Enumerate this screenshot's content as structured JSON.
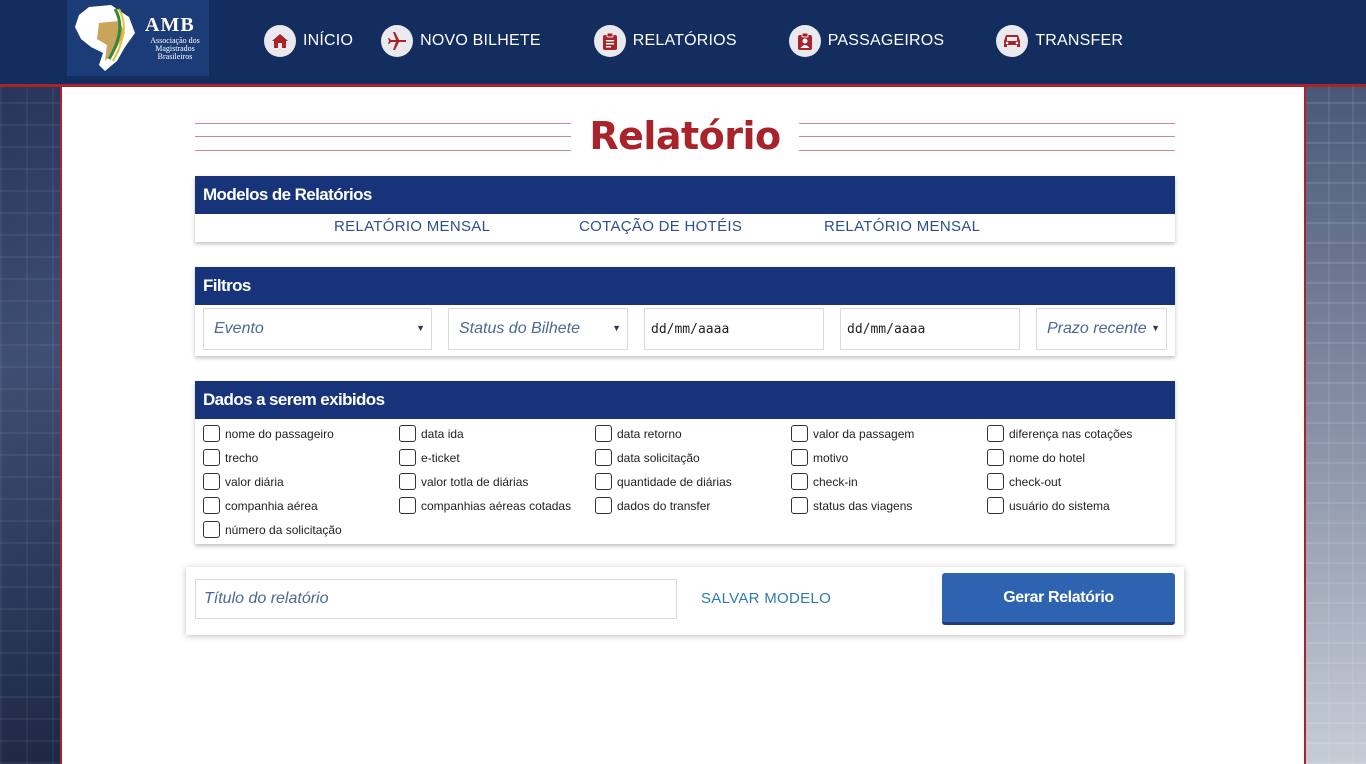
{
  "brand": {
    "logo_name": "AMB",
    "logo_subtitle": "Associação dos Magistrados Brasileiros"
  },
  "nav": {
    "items": [
      {
        "label": "INÍCIO",
        "icon": "home-icon"
      },
      {
        "label": "NOVO BILHETE",
        "icon": "airplane-icon"
      },
      {
        "label": "RELATÓRIOS",
        "icon": "clipboard-icon"
      },
      {
        "label": "PASSAGEIROS",
        "icon": "id-badge-icon"
      },
      {
        "label": "TRANSFER",
        "icon": "car-icon"
      }
    ]
  },
  "page": {
    "title": "Relatório"
  },
  "models": {
    "heading": "Modelos de Relatórios",
    "links": [
      "RELATÓRIO MENSAL",
      "COTAÇÃO DE HOTÉIS",
      "RELATÓRIO MENSAL"
    ]
  },
  "filters": {
    "heading": "Filtros",
    "evento": "Evento",
    "status": "Status do Bilhete",
    "date_from": "dd/mm/aaaa",
    "date_to": "dd/mm/aaaa",
    "prazo": "Prazo recente"
  },
  "data_fields": {
    "heading": "Dados a serem exibidos",
    "columns": [
      [
        "nome do passageiro",
        "trecho",
        "valor diária",
        "companhia aérea",
        "número da solicitação"
      ],
      [
        "data ida",
        "e-ticket",
        "valor totla de diárias",
        "companhias aéreas cotadas"
      ],
      [
        "data retorno",
        "data solicitação",
        "quantidade de diárias",
        "dados do transfer"
      ],
      [
        "valor da passagem",
        "motivo",
        "check-in",
        "status das viagens"
      ],
      [
        "diferença nas cotações",
        "nome do hotel",
        "check-out",
        "usuário do sistema"
      ]
    ]
  },
  "actions": {
    "title_placeholder": "Título do relatório",
    "save_label": "SALVAR MODELO",
    "generate_label": "Gerar Relatório"
  },
  "colors": {
    "header_bg": "#132d5f",
    "accent_red": "#a8232a",
    "card_head": "#17347a",
    "button": "#2e63b1"
  }
}
